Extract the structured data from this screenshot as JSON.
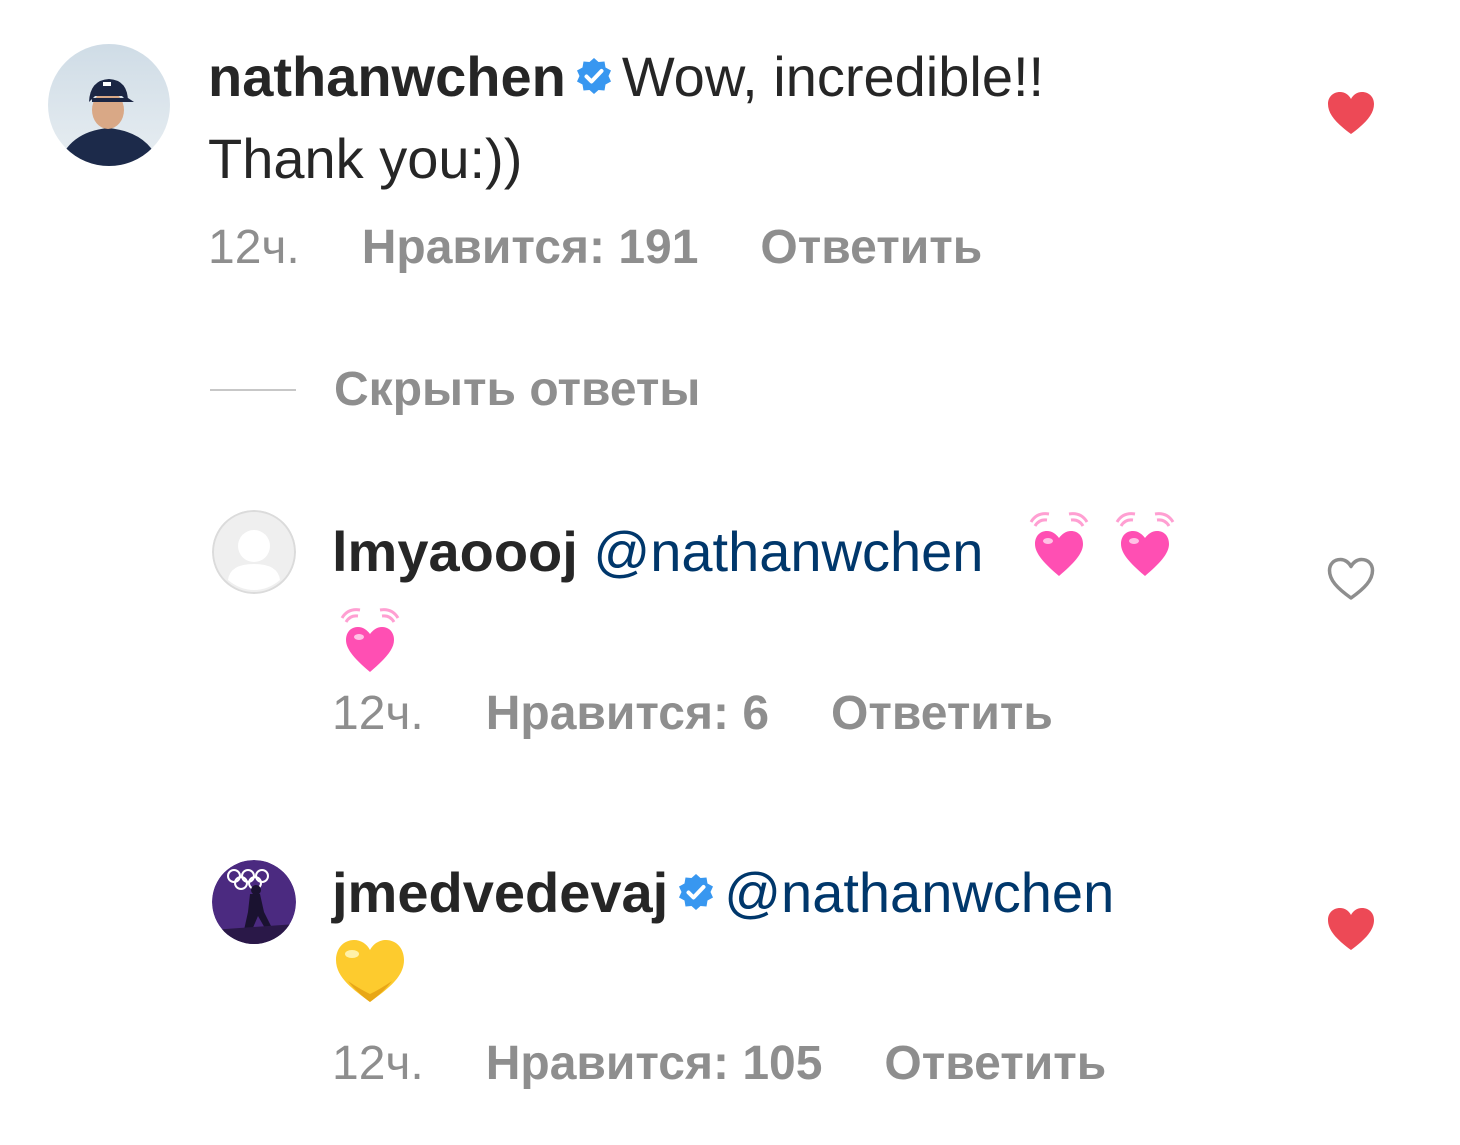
{
  "comments": [
    {
      "username": "nathanwchen",
      "verified": true,
      "text_line1": "Wow, incredible!!",
      "text_line2": "Thank you:))",
      "time": "12ч.",
      "likes": "Нравится: 191",
      "reply": "Ответить",
      "liked": true,
      "avatar_icon": "profile-photo"
    }
  ],
  "hide_replies_label": "Скрыть ответы",
  "replies": [
    {
      "username": "lmyaoooj",
      "verified": false,
      "mention": "@nathanwchen",
      "emojis": [
        "growing-heart-icon",
        "growing-heart-icon",
        "growing-heart-icon"
      ],
      "time": "12ч.",
      "likes": "Нравится: 6",
      "reply": "Ответить",
      "liked": false,
      "avatar_icon": "default-avatar"
    },
    {
      "username": "jmedvedevaj",
      "verified": true,
      "mention": "@nathanwchen",
      "emojis": [
        "yellow-heart-icon"
      ],
      "time": "12ч.",
      "likes": "Нравится: 105",
      "reply": "Ответить",
      "liked": true,
      "avatar_icon": "olympic-skater-avatar"
    }
  ],
  "colors": {
    "text": "#262626",
    "secondary": "#8e8e8e",
    "mention": "#00376b",
    "verified": "#3897f0",
    "liked_heart": "#ed4956",
    "pink_heart": "#ff4fb3",
    "yellow_heart": "#fdcb2e"
  }
}
